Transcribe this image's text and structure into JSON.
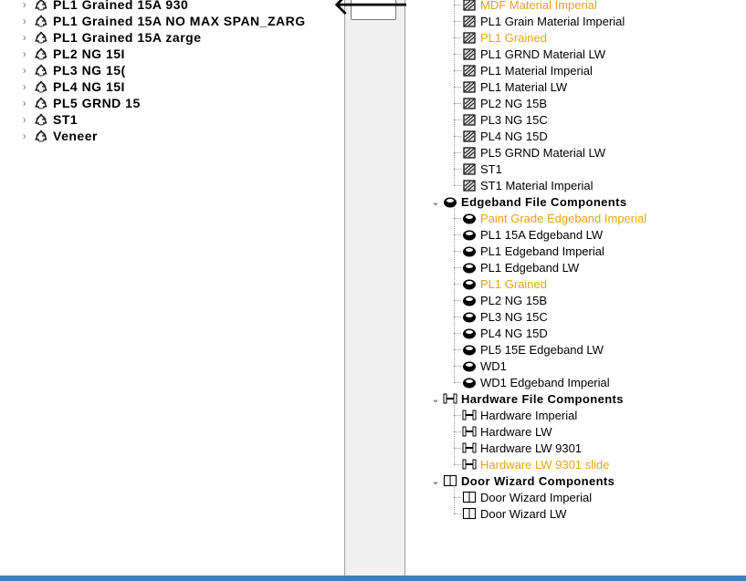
{
  "left_tree": {
    "items": [
      {
        "label": "PL1 Grained 15A 930"
      },
      {
        "label": "PL1 Grained 15A NO MAX SPAN_ZARG"
      },
      {
        "label": "PL1 Grained 15A zarge"
      },
      {
        "label": "PL2 NG 15I"
      },
      {
        "label": "PL3 NG 15("
      },
      {
        "label": "PL4 NG 15I"
      },
      {
        "label": "PL5 GRND 15"
      },
      {
        "label": "ST1"
      },
      {
        "label": "Veneer"
      }
    ],
    "icon": "recycle-icon",
    "expander": "›"
  },
  "middle": {
    "back_arrow": "🡐"
  },
  "right_tree": {
    "material_items": [
      {
        "label": "MDF Material Imperial",
        "highlight": true
      },
      {
        "label": "PL1 Grain Material Imperial",
        "highlight": false
      },
      {
        "label": "PL1 Grained",
        "highlight": true
      },
      {
        "label": "PL1 GRND Material LW",
        "highlight": false
      },
      {
        "label": "PL1 Material Imperial",
        "highlight": false
      },
      {
        "label": "PL1 Material LW",
        "highlight": false
      },
      {
        "label": "PL2 NG 15B",
        "highlight": false
      },
      {
        "label": "PL3 NG 15C",
        "highlight": false
      },
      {
        "label": "PL4 NG 15D",
        "highlight": false
      },
      {
        "label": "PL5 GRND Material LW",
        "highlight": false
      },
      {
        "label": "ST1",
        "highlight": false
      },
      {
        "label": "ST1 Material Imperial",
        "highlight": false
      }
    ],
    "groups": [
      {
        "label": "Edgeband File Components",
        "icon": "edgeband-icon",
        "items": [
          {
            "label": "Paint Grade Edgeband Imperial",
            "highlight": true
          },
          {
            "label": "PL1 15A Edgeband LW",
            "highlight": false
          },
          {
            "label": "PL1 Edgeband Imperial",
            "highlight": false
          },
          {
            "label": "PL1 Edgeband LW",
            "highlight": false
          },
          {
            "label": "PL1 Grained",
            "highlight": true
          },
          {
            "label": "PL2 NG 15B",
            "highlight": false
          },
          {
            "label": "PL3 NG 15C",
            "highlight": false
          },
          {
            "label": "PL4 NG 15D",
            "highlight": false
          },
          {
            "label": "PL5 15E Edgeband LW",
            "highlight": false
          },
          {
            "label": "WD1",
            "highlight": false
          },
          {
            "label": "WD1 Edgeband Imperial",
            "highlight": false
          }
        ]
      },
      {
        "label": "Hardware File Components",
        "icon": "hardware-icon",
        "items": [
          {
            "label": "Hardware Imperial",
            "highlight": false
          },
          {
            "label": "Hardware LW",
            "highlight": false
          },
          {
            "label": "Hardware LW 9301",
            "highlight": false
          },
          {
            "label": "Hardware LW 9301 slide",
            "highlight": true
          }
        ]
      },
      {
        "label": "Door Wizard Components",
        "icon": "door-wizard-icon",
        "items": [
          {
            "label": "Door Wizard Imperial",
            "highlight": false
          },
          {
            "label": "Door Wizard LW",
            "highlight": false
          }
        ]
      }
    ],
    "expanded_chevron": "⌄"
  },
  "colors": {
    "highlight": "#e8a317",
    "panel_gray": "#f0f0f0",
    "bottom_bar": "#3a7fc0"
  }
}
